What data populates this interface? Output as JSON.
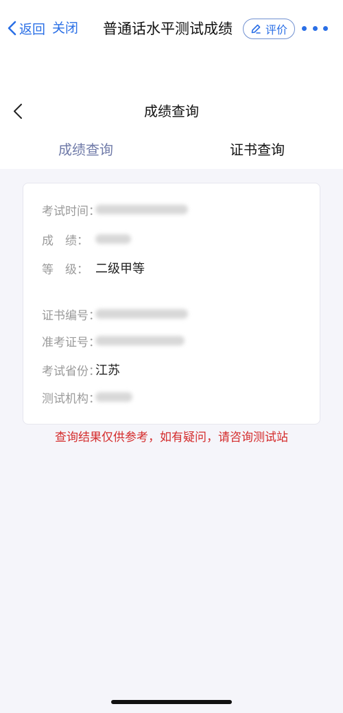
{
  "topbar": {
    "back_label": "返回",
    "close_label": "关闭",
    "title": "普通话水平测试成绩",
    "rate_label": "评价"
  },
  "sub_header": {
    "title": "成绩查询"
  },
  "tabs": [
    {
      "label": "成绩查询",
      "active": true
    },
    {
      "label": "证书查询",
      "active": false
    }
  ],
  "result": {
    "rows": [
      {
        "label": "考试时间：",
        "value": ""
      },
      {
        "label_a": "成",
        "label_b": "绩：",
        "value": ""
      },
      {
        "label_a": "等",
        "label_b": "级：",
        "value": "二级甲等"
      },
      {
        "label": "证书编号：",
        "value": ""
      },
      {
        "label": "准考证号：",
        "value": ""
      },
      {
        "label": "考试省份：",
        "value": "江苏"
      },
      {
        "label": "测试机构：",
        "value": ""
      }
    ]
  },
  "notice": "查询结果仅供参考，如有疑问，请咨询测试站",
  "colors": {
    "accent": "#2a6fe6",
    "active_tab": "#6f7aa8",
    "notice": "#d42b2b",
    "background": "#f5f5fa"
  }
}
